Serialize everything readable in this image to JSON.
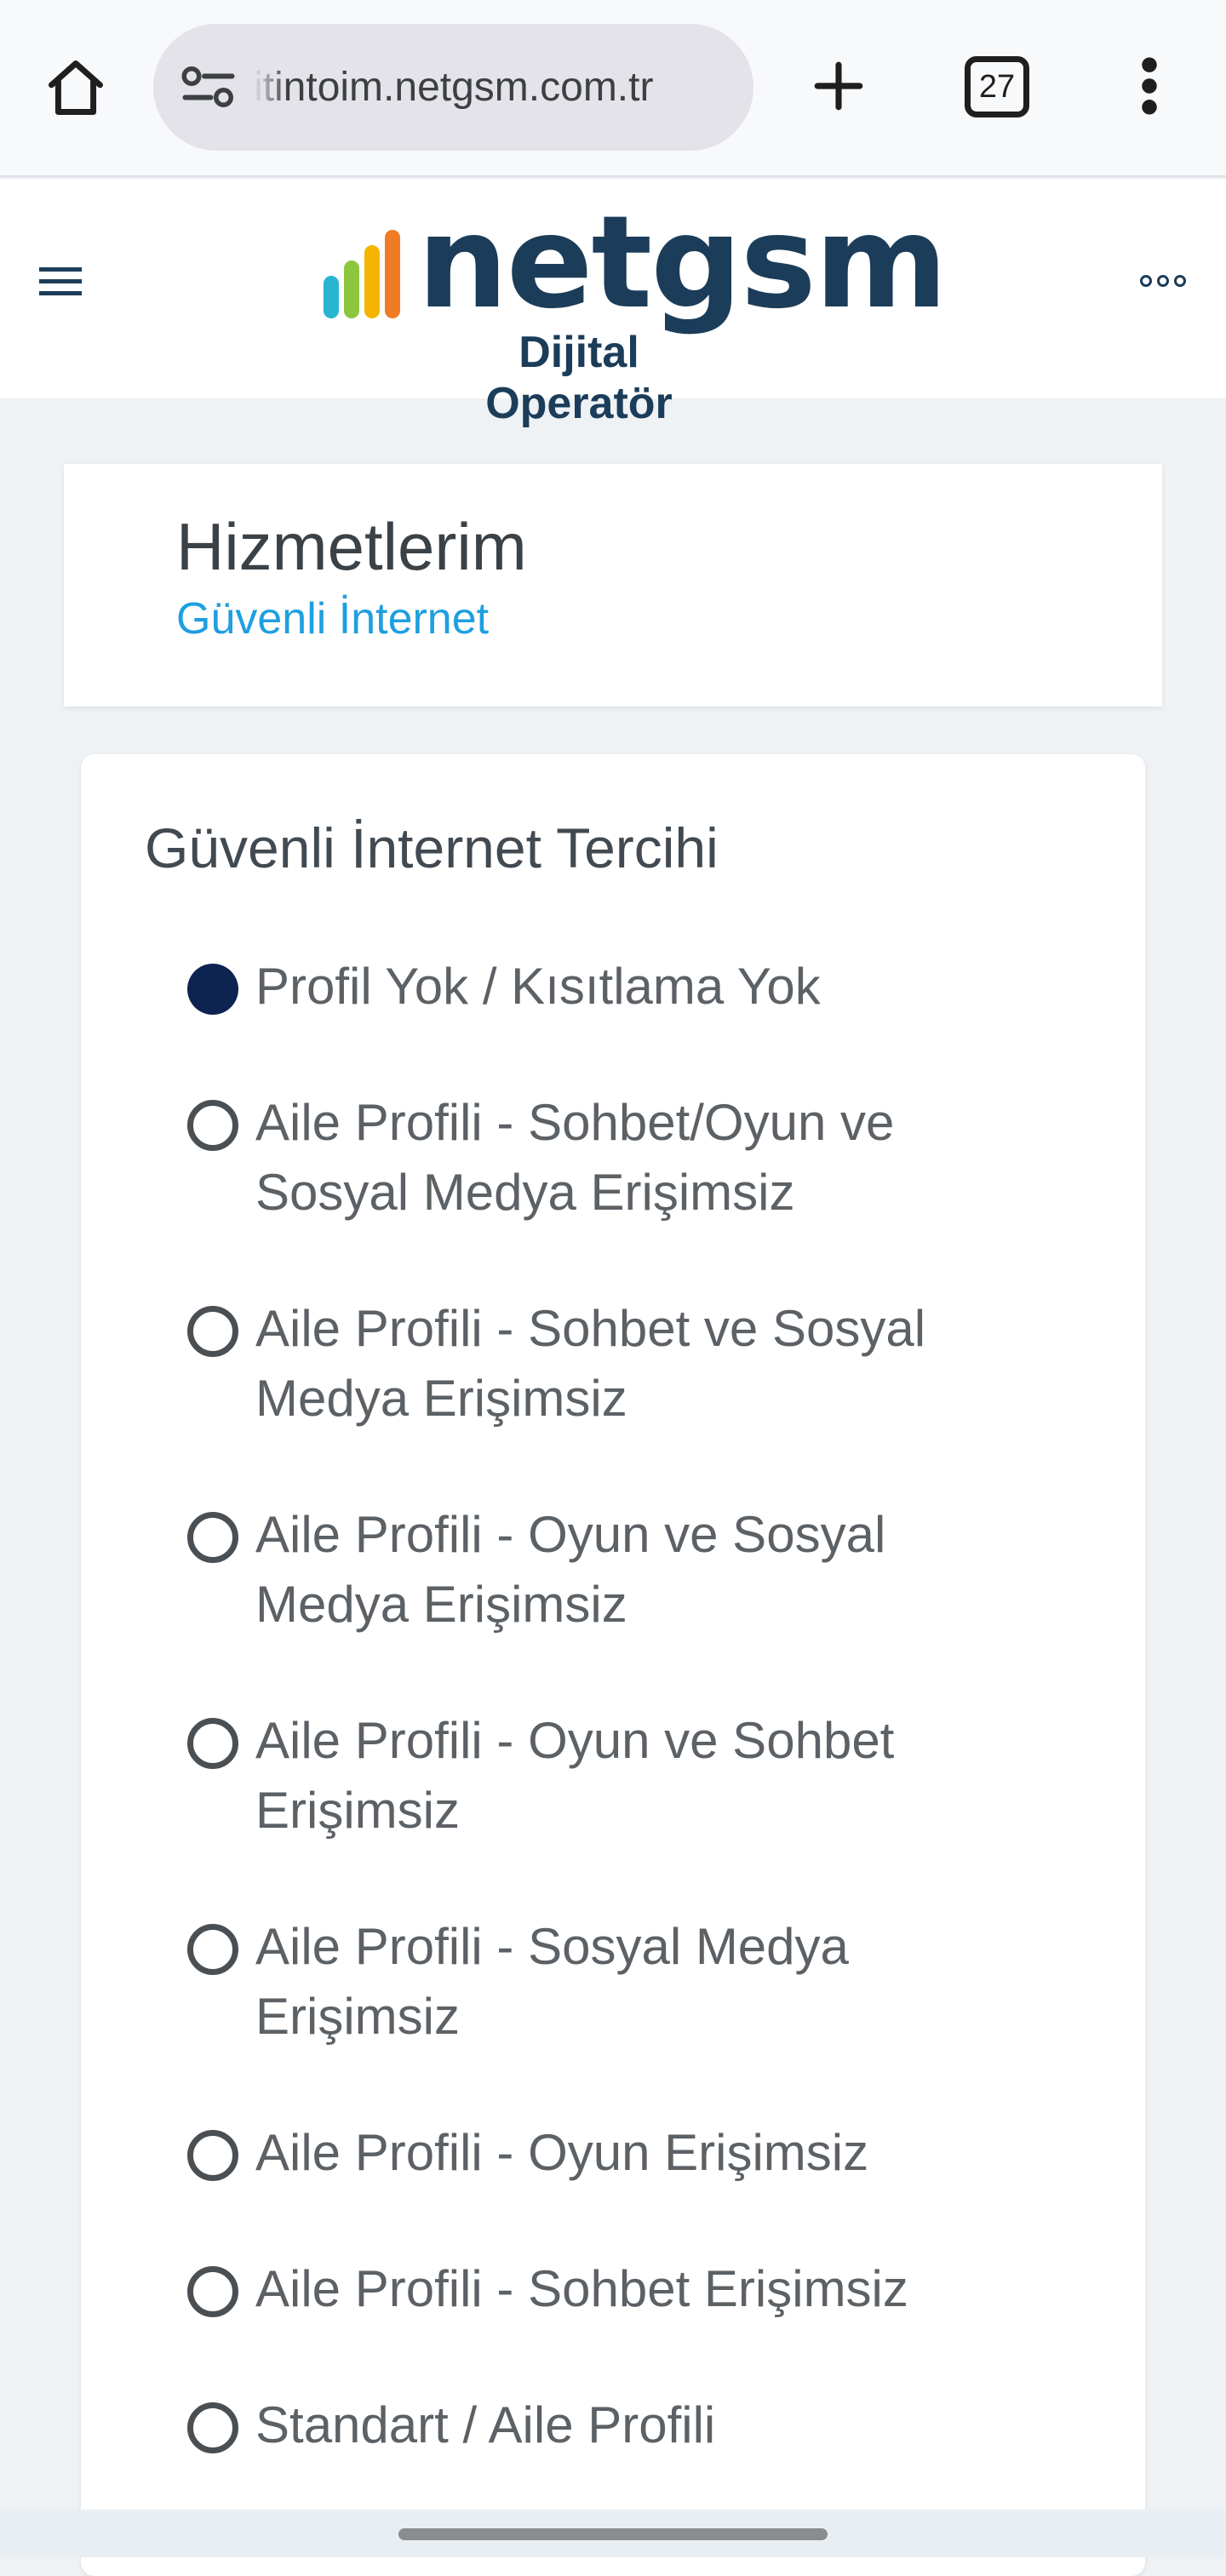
{
  "browser": {
    "url": "itintoim.netgsm.com.tr",
    "tab_count": "27",
    "icons": {
      "home": "home-icon",
      "site_info": "tune-icon",
      "new_tab": "plus-icon",
      "menu": "vertical-dots-icon"
    }
  },
  "header": {
    "logo_word": "netgsm",
    "logo_sub": "Dijital Operatör",
    "colors": {
      "brand_dark": "#1c3d59",
      "bar1": "#27b5cf",
      "bar2": "#8cc63e",
      "bar3": "#f4b400",
      "bar4": "#f07b24"
    }
  },
  "title_card": {
    "title": "Hizmetlerim",
    "breadcrumb": "Güvenli İnternet"
  },
  "preference": {
    "title": "Güvenli İnternet Tercihi",
    "selected_index": 0,
    "options": [
      {
        "label": "Profil Yok / Kısıtlama Yok"
      },
      {
        "label": "Aile Profili - Sohbet/Oyun ve Sosyal Medya Erişimsiz"
      },
      {
        "label": "Aile Profili - Sohbet ve Sosyal Medya Erişimsiz"
      },
      {
        "label": "Aile Profili - Oyun ve Sosyal Medya Erişimsiz"
      },
      {
        "label": "Aile Profili - Oyun ve Sohbet Erişimsiz"
      },
      {
        "label": "Aile Profili - Sosyal Medya Erişimsiz"
      },
      {
        "label": "Aile Profili - Oyun Erişimsiz"
      },
      {
        "label": "Aile Profili - Sohbet Erişimsiz"
      },
      {
        "label": "Standart / Aile Profili"
      }
    ]
  }
}
